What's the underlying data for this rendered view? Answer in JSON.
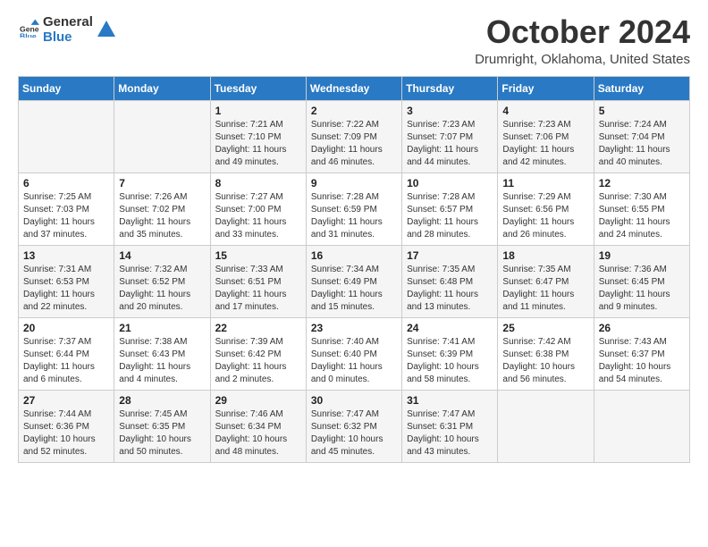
{
  "header": {
    "logo_general": "General",
    "logo_blue": "Blue",
    "month": "October 2024",
    "location": "Drumright, Oklahoma, United States"
  },
  "days_of_week": [
    "Sunday",
    "Monday",
    "Tuesday",
    "Wednesday",
    "Thursday",
    "Friday",
    "Saturday"
  ],
  "weeks": [
    [
      {
        "day": "",
        "info": ""
      },
      {
        "day": "",
        "info": ""
      },
      {
        "day": "1",
        "info": "Sunrise: 7:21 AM\nSunset: 7:10 PM\nDaylight: 11 hours and 49 minutes."
      },
      {
        "day": "2",
        "info": "Sunrise: 7:22 AM\nSunset: 7:09 PM\nDaylight: 11 hours and 46 minutes."
      },
      {
        "day": "3",
        "info": "Sunrise: 7:23 AM\nSunset: 7:07 PM\nDaylight: 11 hours and 44 minutes."
      },
      {
        "day": "4",
        "info": "Sunrise: 7:23 AM\nSunset: 7:06 PM\nDaylight: 11 hours and 42 minutes."
      },
      {
        "day": "5",
        "info": "Sunrise: 7:24 AM\nSunset: 7:04 PM\nDaylight: 11 hours and 40 minutes."
      }
    ],
    [
      {
        "day": "6",
        "info": "Sunrise: 7:25 AM\nSunset: 7:03 PM\nDaylight: 11 hours and 37 minutes."
      },
      {
        "day": "7",
        "info": "Sunrise: 7:26 AM\nSunset: 7:02 PM\nDaylight: 11 hours and 35 minutes."
      },
      {
        "day": "8",
        "info": "Sunrise: 7:27 AM\nSunset: 7:00 PM\nDaylight: 11 hours and 33 minutes."
      },
      {
        "day": "9",
        "info": "Sunrise: 7:28 AM\nSunset: 6:59 PM\nDaylight: 11 hours and 31 minutes."
      },
      {
        "day": "10",
        "info": "Sunrise: 7:28 AM\nSunset: 6:57 PM\nDaylight: 11 hours and 28 minutes."
      },
      {
        "day": "11",
        "info": "Sunrise: 7:29 AM\nSunset: 6:56 PM\nDaylight: 11 hours and 26 minutes."
      },
      {
        "day": "12",
        "info": "Sunrise: 7:30 AM\nSunset: 6:55 PM\nDaylight: 11 hours and 24 minutes."
      }
    ],
    [
      {
        "day": "13",
        "info": "Sunrise: 7:31 AM\nSunset: 6:53 PM\nDaylight: 11 hours and 22 minutes."
      },
      {
        "day": "14",
        "info": "Sunrise: 7:32 AM\nSunset: 6:52 PM\nDaylight: 11 hours and 20 minutes."
      },
      {
        "day": "15",
        "info": "Sunrise: 7:33 AM\nSunset: 6:51 PM\nDaylight: 11 hours and 17 minutes."
      },
      {
        "day": "16",
        "info": "Sunrise: 7:34 AM\nSunset: 6:49 PM\nDaylight: 11 hours and 15 minutes."
      },
      {
        "day": "17",
        "info": "Sunrise: 7:35 AM\nSunset: 6:48 PM\nDaylight: 11 hours and 13 minutes."
      },
      {
        "day": "18",
        "info": "Sunrise: 7:35 AM\nSunset: 6:47 PM\nDaylight: 11 hours and 11 minutes."
      },
      {
        "day": "19",
        "info": "Sunrise: 7:36 AM\nSunset: 6:45 PM\nDaylight: 11 hours and 9 minutes."
      }
    ],
    [
      {
        "day": "20",
        "info": "Sunrise: 7:37 AM\nSunset: 6:44 PM\nDaylight: 11 hours and 6 minutes."
      },
      {
        "day": "21",
        "info": "Sunrise: 7:38 AM\nSunset: 6:43 PM\nDaylight: 11 hours and 4 minutes."
      },
      {
        "day": "22",
        "info": "Sunrise: 7:39 AM\nSunset: 6:42 PM\nDaylight: 11 hours and 2 minutes."
      },
      {
        "day": "23",
        "info": "Sunrise: 7:40 AM\nSunset: 6:40 PM\nDaylight: 11 hours and 0 minutes."
      },
      {
        "day": "24",
        "info": "Sunrise: 7:41 AM\nSunset: 6:39 PM\nDaylight: 10 hours and 58 minutes."
      },
      {
        "day": "25",
        "info": "Sunrise: 7:42 AM\nSunset: 6:38 PM\nDaylight: 10 hours and 56 minutes."
      },
      {
        "day": "26",
        "info": "Sunrise: 7:43 AM\nSunset: 6:37 PM\nDaylight: 10 hours and 54 minutes."
      }
    ],
    [
      {
        "day": "27",
        "info": "Sunrise: 7:44 AM\nSunset: 6:36 PM\nDaylight: 10 hours and 52 minutes."
      },
      {
        "day": "28",
        "info": "Sunrise: 7:45 AM\nSunset: 6:35 PM\nDaylight: 10 hours and 50 minutes."
      },
      {
        "day": "29",
        "info": "Sunrise: 7:46 AM\nSunset: 6:34 PM\nDaylight: 10 hours and 48 minutes."
      },
      {
        "day": "30",
        "info": "Sunrise: 7:47 AM\nSunset: 6:32 PM\nDaylight: 10 hours and 45 minutes."
      },
      {
        "day": "31",
        "info": "Sunrise: 7:47 AM\nSunset: 6:31 PM\nDaylight: 10 hours and 43 minutes."
      },
      {
        "day": "",
        "info": ""
      },
      {
        "day": "",
        "info": ""
      }
    ]
  ]
}
